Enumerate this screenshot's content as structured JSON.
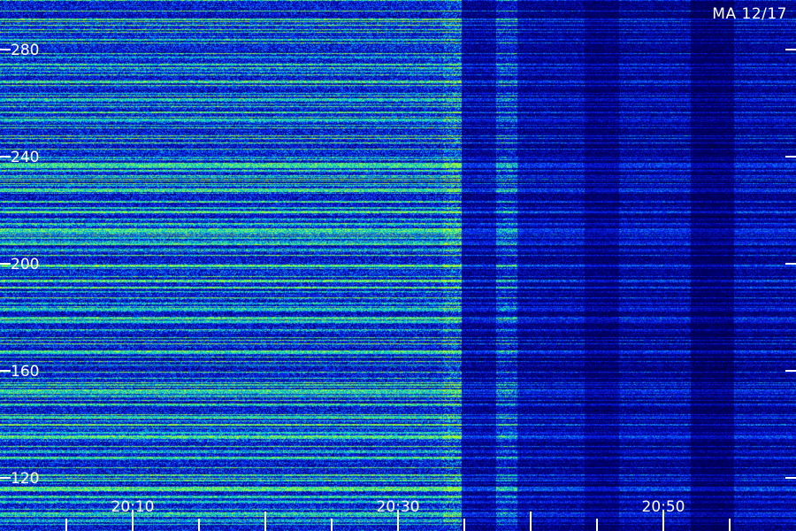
{
  "station_label": "MA 12/17",
  "colors": {
    "background": "#000010",
    "low": "#08087a",
    "mid": "#1a3cff",
    "high": "#00e0c0",
    "peak": "#b0ff40",
    "text": "#ffffff"
  },
  "chart_data": {
    "type": "heatmap",
    "title": "",
    "xlabel": "",
    "ylabel": "",
    "x_tick_labels": [
      "20:10",
      "20:30",
      "20:50"
    ],
    "y_tick_labels": [
      "120",
      "160",
      "200",
      "240",
      "280"
    ],
    "y_ticks": [
      120,
      160,
      200,
      240,
      280
    ],
    "ylim": [
      104,
      297
    ],
    "xlim_minutes": [
      2,
      2
    ]
  }
}
